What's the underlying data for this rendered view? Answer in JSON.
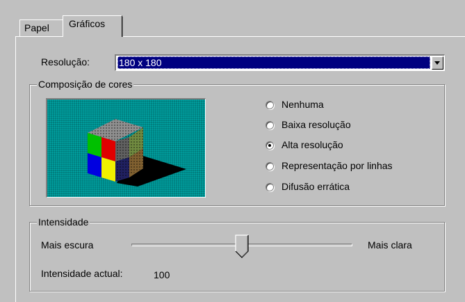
{
  "tabs": [
    {
      "label": "Papel",
      "active": false
    },
    {
      "label": "Gráficos",
      "active": true
    }
  ],
  "resolution": {
    "label": "Resolução:",
    "value": "180 x 180"
  },
  "color_composition": {
    "label": "Composição de cores",
    "options": [
      {
        "label": "Nenhuma",
        "checked": false
      },
      {
        "label": "Baixa resolução",
        "checked": false
      },
      {
        "label": "Alta resolução",
        "checked": true
      },
      {
        "label": "Representação por linhas",
        "checked": false
      },
      {
        "label": "Difusão errática",
        "checked": false
      }
    ]
  },
  "intensity": {
    "label": "Intensidade",
    "min_label": "Mais escura",
    "max_label": "Mais clara",
    "current_label": "Intensidade actual:",
    "current_value": "100",
    "slider_fraction": 0.5
  },
  "colors": {
    "face": "#c0c0c0",
    "highlight": "#000080",
    "preview_bg": "#008080"
  }
}
